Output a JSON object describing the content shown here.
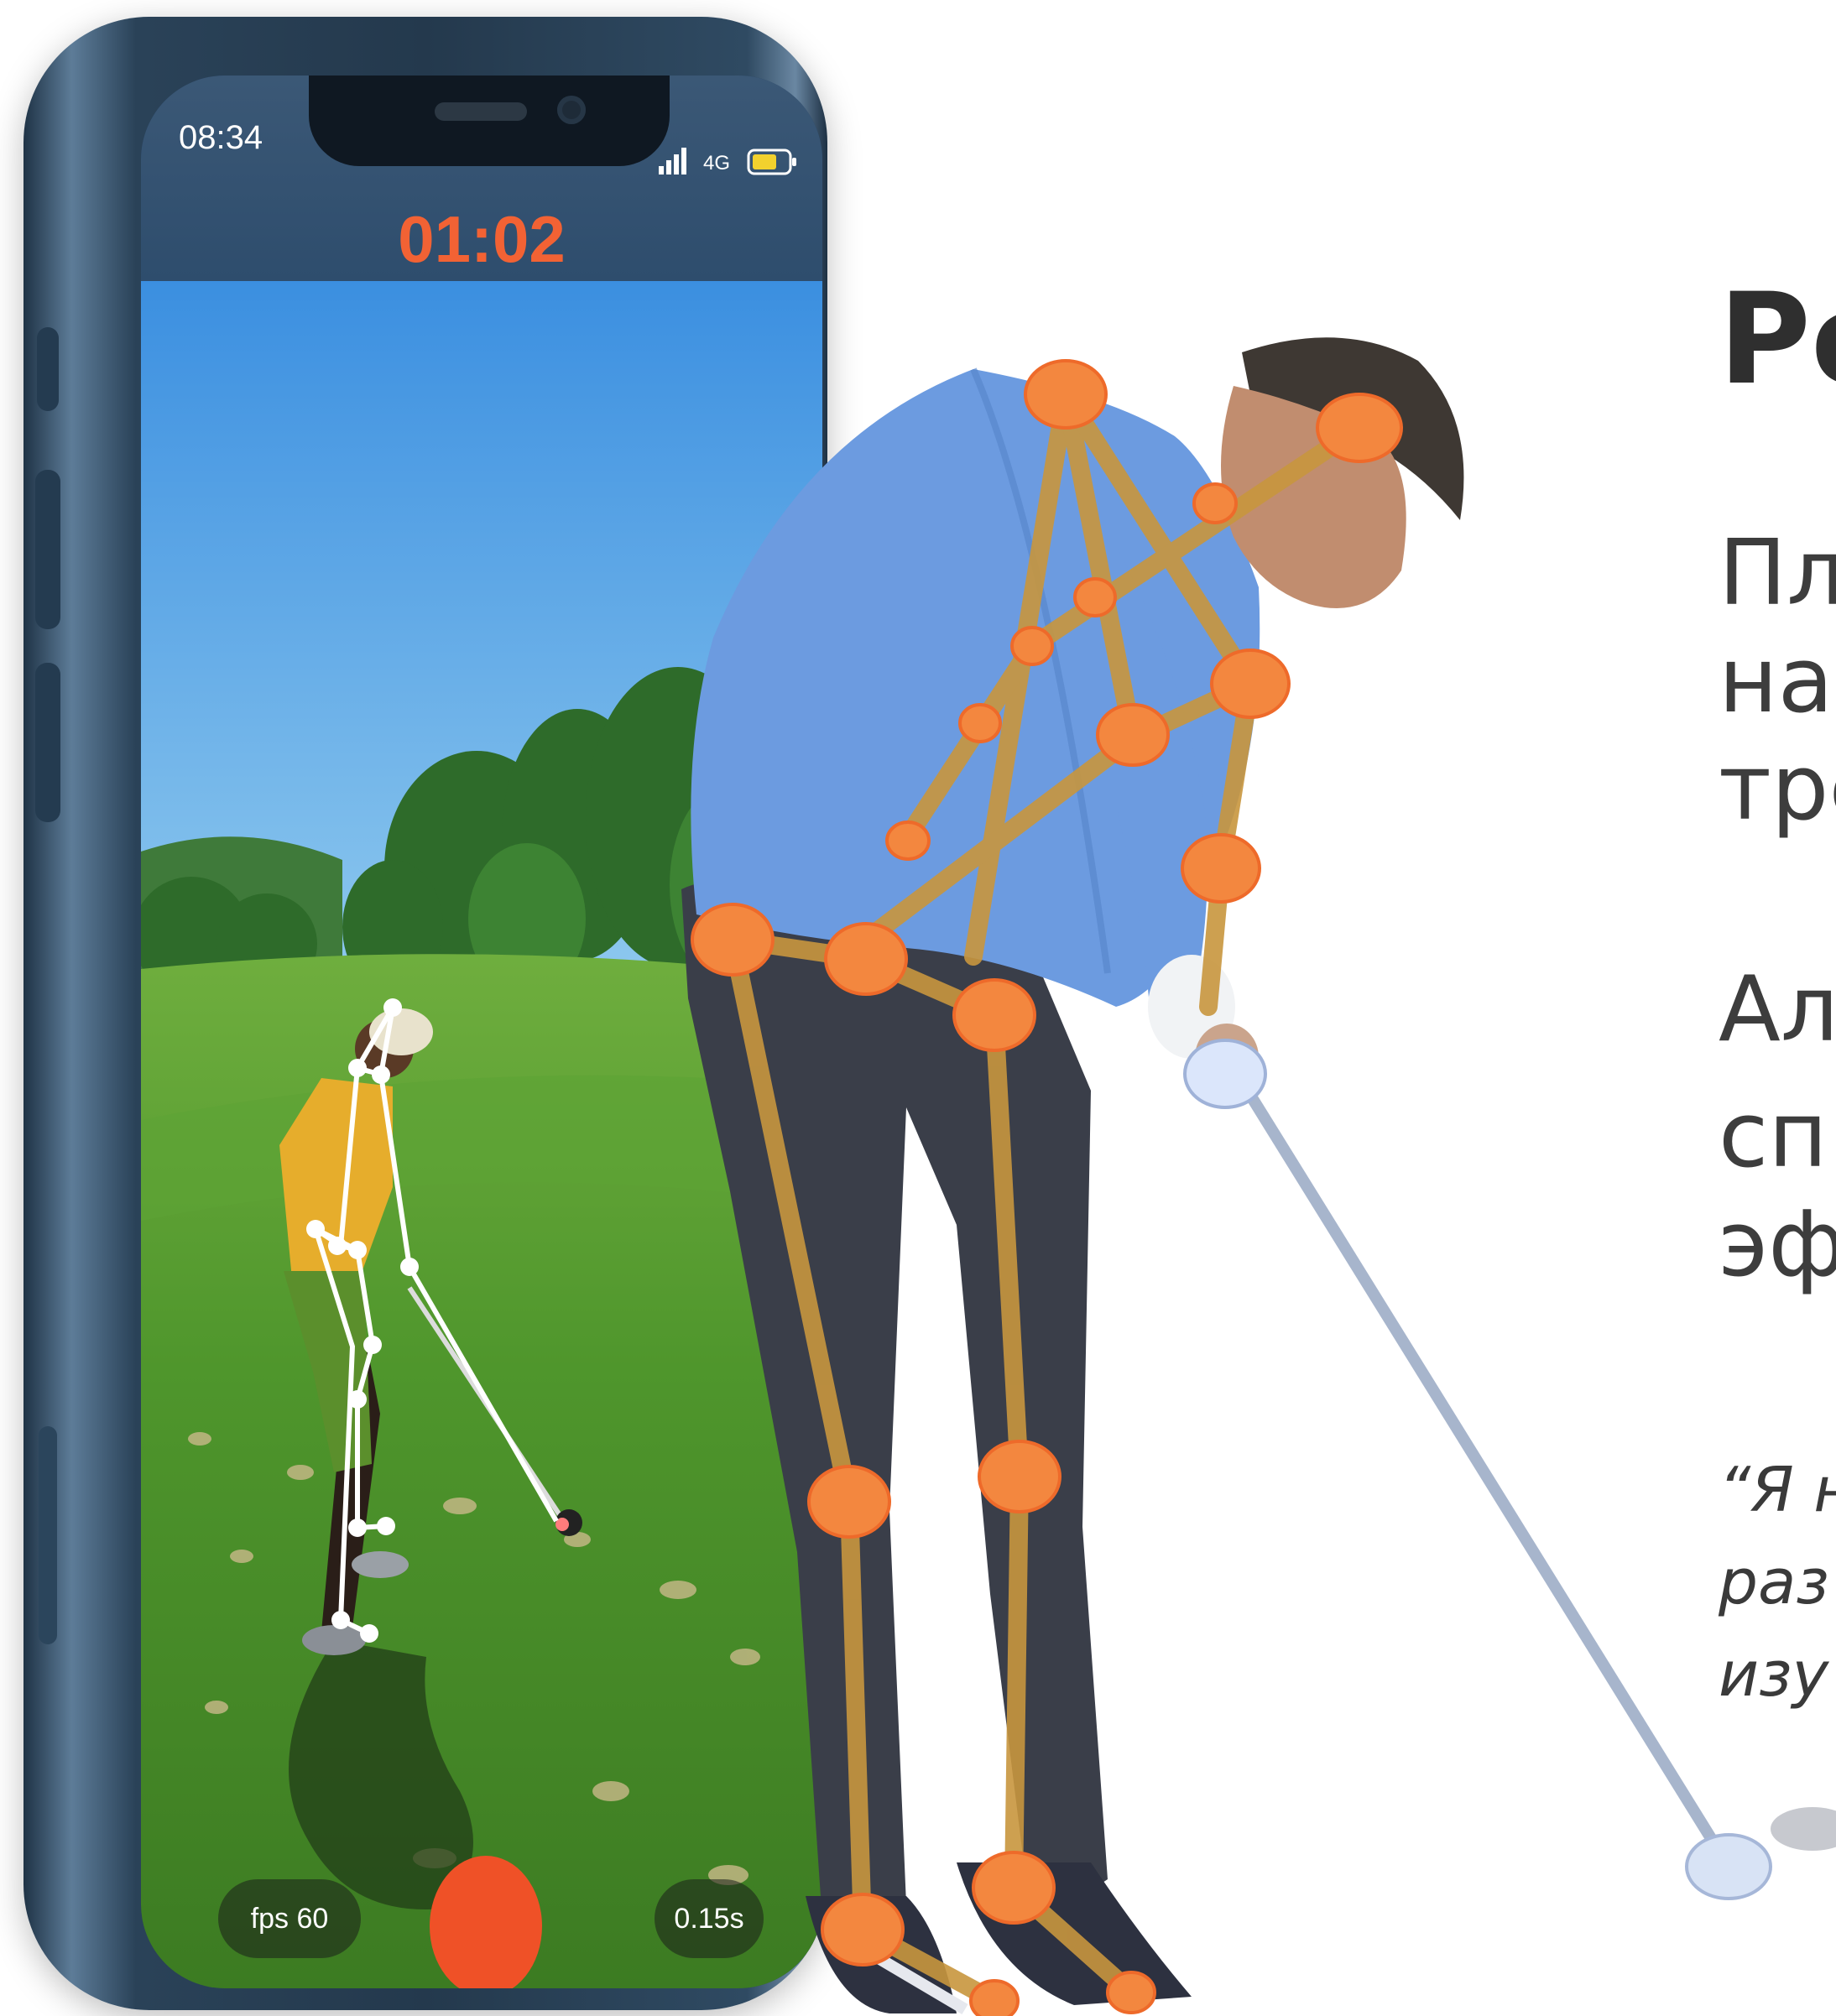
{
  "phone": {
    "status_time": "08:34",
    "network": "4G",
    "timer": "01:02",
    "fps_label": "fps 60",
    "exposure_label": "0.15s",
    "icons": [
      "signal-icon",
      "battery-icon",
      "record-icon"
    ]
  },
  "content": {
    "title": "Po",
    "paragraph1": [
      "Пл",
      "на",
      "тре"
    ],
    "paragraph2": [
      "Ал",
      "сп",
      "эф"
    ],
    "quote": [
      "“Я н",
      "раз",
      "изу"
    ]
  },
  "colors": {
    "timer": "#f26234",
    "record": "#ef5127",
    "joint": "#f3873f",
    "bone": "#c8963e",
    "screen_header": "#2e4d6d"
  }
}
